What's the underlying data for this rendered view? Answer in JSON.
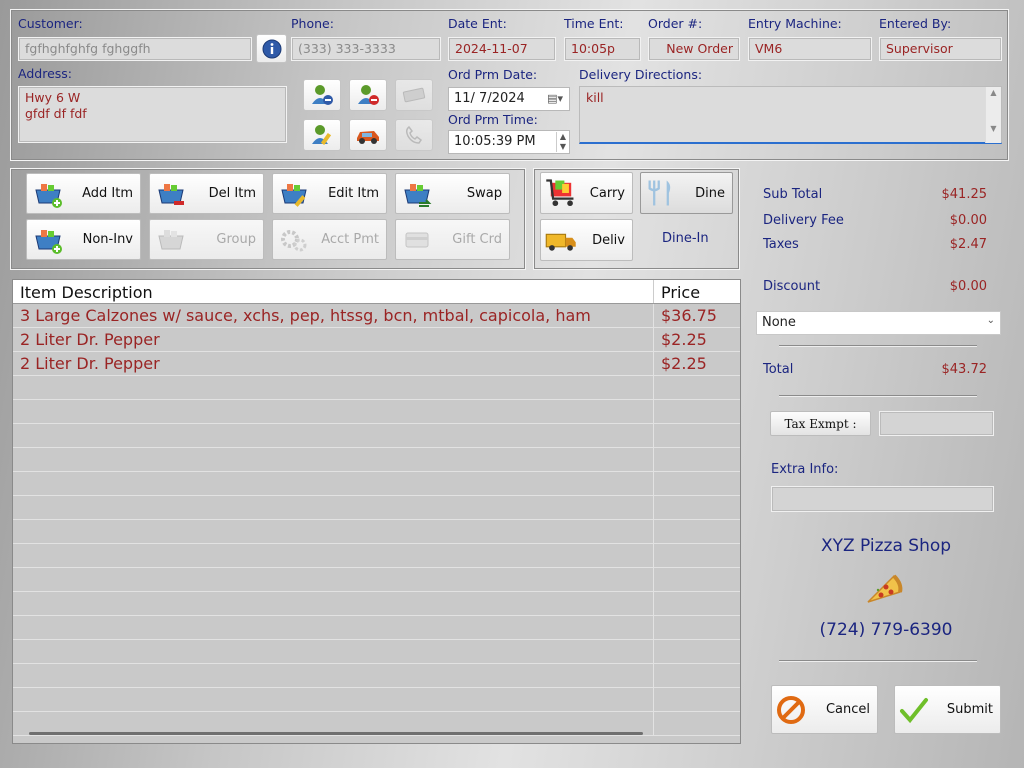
{
  "customer": {
    "label": "Customer:",
    "value": "fgfhghfghfg fghggfh",
    "phone_label": "Phone:",
    "phone_value": "(333) 333-3333",
    "address_label": "Address:",
    "address_line1": "Hwy 6 W",
    "address_line2": "gfdf df  fdf"
  },
  "order_info": {
    "date_ent_label": "Date Ent:",
    "date_ent": "2024-11-07",
    "time_ent_label": "Time Ent:",
    "time_ent": "10:05p",
    "order_no_label": "Order #:",
    "order_no": "New Order",
    "entry_machine_label": "Entry Machine:",
    "entry_machine": "VM6",
    "entered_by_label": "Entered By:",
    "entered_by": "Supervisor",
    "ord_prm_date_label": "Ord Prm Date:",
    "ord_prm_date": "11/  7/2024",
    "ord_prm_time_label": "Ord Prm Time:",
    "ord_prm_time": "10:05:39 PM",
    "delivery_directions_label": "Delivery Directions:",
    "delivery_directions": "kill"
  },
  "item_buttons": {
    "add": "Add Itm",
    "del": "Del Itm",
    "edit": "Edit Itm",
    "swap": "Swap",
    "non_inv": "Non-Inv",
    "group": "Group",
    "acct_pmt": "Acct Pmt",
    "gift_crd": "Gift Crd"
  },
  "order_type": {
    "carry": "Carry",
    "dine": "Dine",
    "deliv": "Deliv",
    "selected_label": "Dine-In"
  },
  "items_table": {
    "col_desc": "Item Description",
    "col_price": "Price",
    "rows": [
      {
        "desc": "3 Large Calzones w/ sauce, xchs, pep, htssg, bcn, mtbal, capicola, ham",
        "price": "$36.75"
      },
      {
        "desc": "2 Liter Dr. Pepper",
        "price": "$2.25"
      },
      {
        "desc": "2 Liter Dr. Pepper",
        "price": "$2.25"
      }
    ]
  },
  "summary": {
    "subtotal_label": "Sub Total",
    "subtotal": "$41.25",
    "delivery_fee_label": "Delivery Fee",
    "delivery_fee": "$0.00",
    "taxes_label": "Taxes",
    "taxes": "$2.47",
    "discount_label": "Discount",
    "discount": "$0.00",
    "discount_select": "None",
    "total_label": "Total",
    "total": "$43.72",
    "tax_exempt_button": "Tax Exmpt :",
    "extra_info_label": "Extra Info:"
  },
  "shop": {
    "name": "XYZ Pizza Shop",
    "phone": "(724) 779-6390"
  },
  "actions": {
    "cancel": "Cancel",
    "submit": "Submit"
  }
}
